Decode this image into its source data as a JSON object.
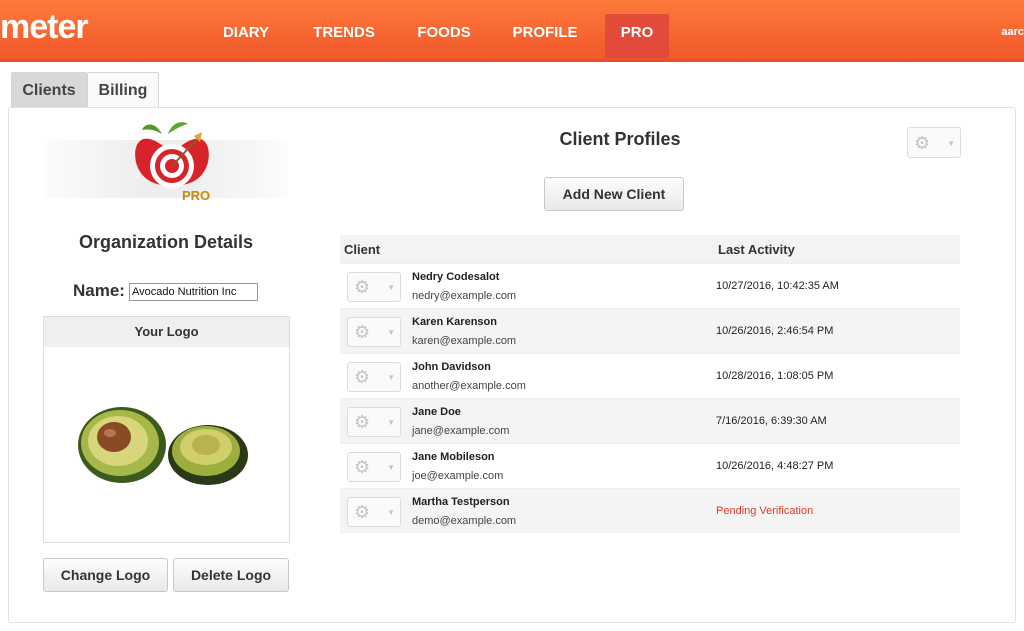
{
  "header": {
    "brand": "meter",
    "nav": [
      {
        "label": "DIARY",
        "active": false
      },
      {
        "label": "TRENDS",
        "active": false
      },
      {
        "label": "FOODS",
        "active": false
      },
      {
        "label": "PROFILE",
        "active": false
      },
      {
        "label": "PRO",
        "active": true
      }
    ],
    "user": "aarc"
  },
  "tabs": [
    {
      "label": "Clients",
      "active": true
    },
    {
      "label": "Billing",
      "active": false
    }
  ],
  "organization": {
    "title": "Organization Details",
    "name_label": "Name:",
    "name_value": "Avocado Nutrition Inc",
    "logo_box_title": "Your Logo",
    "change_logo": "Change Logo",
    "delete_logo": "Delete Logo",
    "pro_badge": "PRO"
  },
  "clients": {
    "title": "Client Profiles",
    "add_button": "Add New Client",
    "col_client": "Client",
    "col_activity": "Last Activity",
    "rows": [
      {
        "name": "Nedry Codesalot",
        "email": "nedry@example.com",
        "activity": "10/27/2016, 10:42:35 AM",
        "pending": false
      },
      {
        "name": "Karen Karenson",
        "email": "karen@example.com",
        "activity": "10/26/2016, 2:46:54 PM",
        "pending": false
      },
      {
        "name": "John Davidson",
        "email": "another@example.com",
        "activity": "10/28/2016, 1:08:05 PM",
        "pending": false
      },
      {
        "name": "Jane Doe",
        "email": "jane@example.com",
        "activity": "7/16/2016, 6:39:30 AM",
        "pending": false
      },
      {
        "name": "Jane Mobileson",
        "email": "joe@example.com",
        "activity": "10/26/2016, 4:48:27 PM",
        "pending": false
      },
      {
        "name": "Martha Testperson",
        "email": "demo@example.com",
        "activity": "Pending Verification",
        "pending": true
      }
    ]
  },
  "colors": {
    "header": "#f0582a",
    "active_nav": "#e24a3a",
    "pending": "#e03a2a"
  }
}
